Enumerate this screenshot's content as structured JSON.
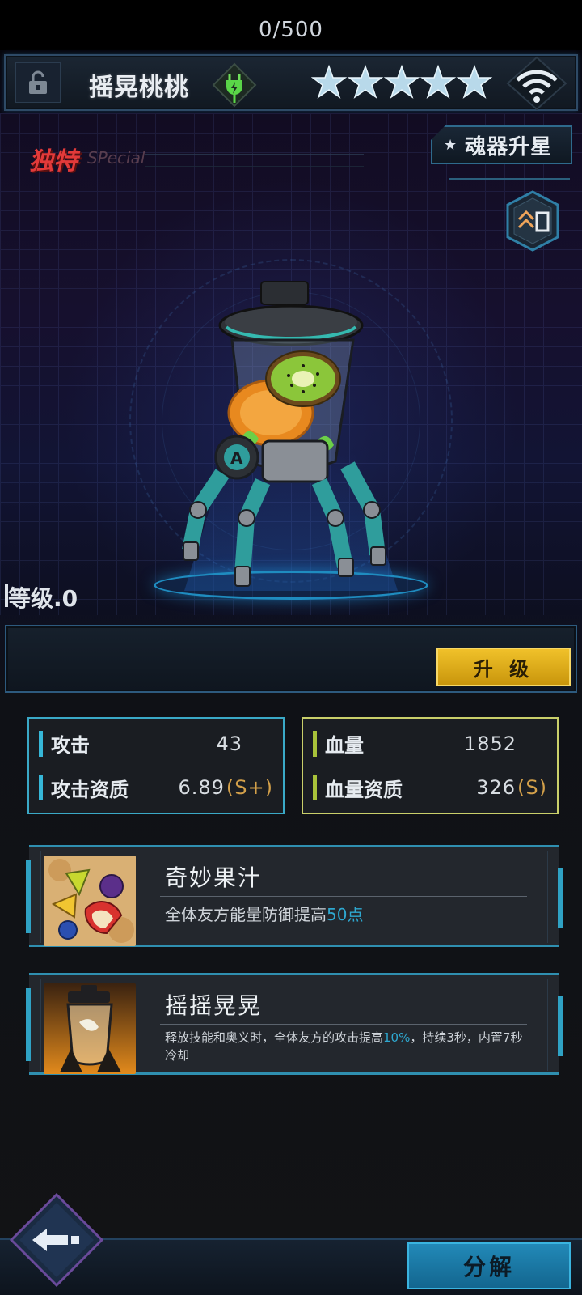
{
  "header": {
    "name": "摇晃桃桃",
    "star_count": 5
  },
  "hero": {
    "rarity": "独特",
    "rarity_en": "SPecial",
    "upstar_label": "魂器升星",
    "level_label": "等级.0"
  },
  "exp": {
    "text": "0/500",
    "upgrade_label": "升 级"
  },
  "stats": {
    "attack_label": "攻击",
    "attack_value": "43",
    "attack_quality_label": "攻击资质",
    "attack_quality_value": "6.89",
    "attack_quality_grade": "(S+)",
    "hp_label": "血量",
    "hp_value": "1852",
    "hp_quality_label": "血量资质",
    "hp_quality_value": "326",
    "hp_quality_grade": "(S)"
  },
  "skills": [
    {
      "title": "奇妙果汁",
      "desc_prefix": "全体友方能量防御提高",
      "desc_highlight": "50点",
      "desc_suffix": ""
    },
    {
      "title": "摇摇晃晃",
      "desc_prefix": "释放技能和奥义时，全体友方的攻击提高",
      "desc_highlight": "10%",
      "desc_suffix": "，持续3秒，内置7秒冷却"
    }
  ],
  "bottom": {
    "decompose_label": "分解"
  },
  "colors": {
    "attack_accent": "#36b7d8",
    "hp_accent": "#a8c23a",
    "upgrade_button": "#e0b01e",
    "decompose_button": "#1c7aa8",
    "rarity_red": "#e23a3a"
  }
}
